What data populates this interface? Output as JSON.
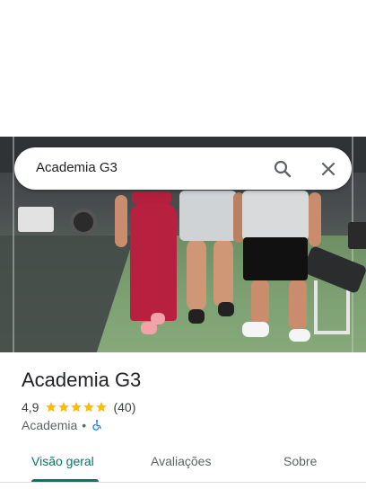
{
  "search": {
    "query": "Academia G3"
  },
  "place": {
    "name": "Academia G3",
    "rating": "4,9",
    "stars": 5,
    "review_count": "(40)",
    "category": "Academia",
    "separator": "•",
    "accessibility_icon": "wheelchair-icon"
  },
  "tabs": [
    {
      "label": "Visão geral",
      "active": true
    },
    {
      "label": "Avaliações",
      "active": false
    },
    {
      "label": "Sobre",
      "active": false
    }
  ],
  "colors": {
    "accent": "#00796b",
    "star": "#fbbc04",
    "access_icon": "#1a73e8"
  }
}
